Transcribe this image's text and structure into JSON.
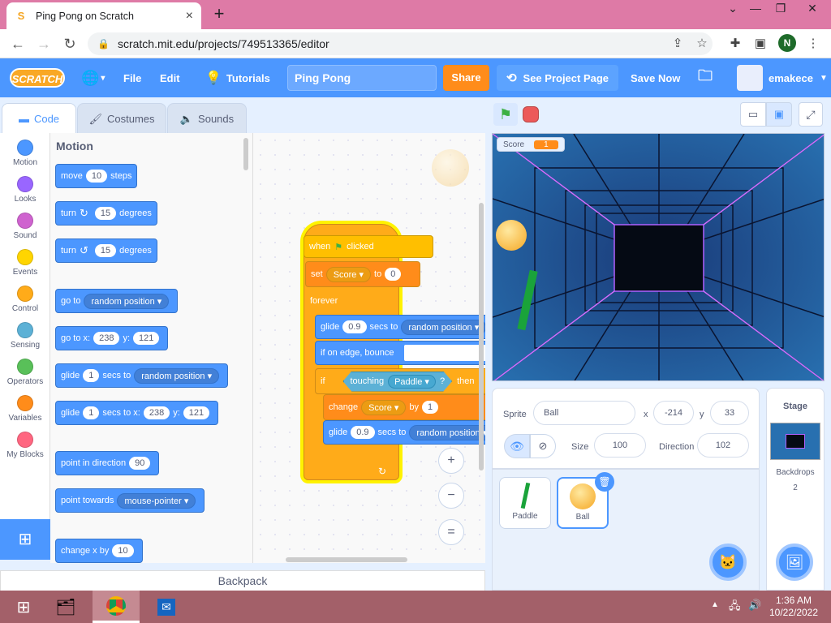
{
  "browser": {
    "tab_title": "Ping Pong on Scratch",
    "tab_favicon": "S",
    "new_tab": "+",
    "url": "scratch.mit.edu/projects/749513365/editor",
    "profile_initial": "N"
  },
  "menubar": {
    "logo": "SCRATCH",
    "file": "File",
    "edit": "Edit",
    "tutorials": "Tutorials",
    "project_title": "Ping Pong",
    "share": "Share",
    "see_project": "See Project Page",
    "save_now": "Save Now",
    "username": "emakece"
  },
  "tabs": {
    "code": "Code",
    "costumes": "Costumes",
    "sounds": "Sounds"
  },
  "categories": [
    {
      "label": "Motion",
      "color": "#4c97ff"
    },
    {
      "label": "Looks",
      "color": "#9966ff"
    },
    {
      "label": "Sound",
      "color": "#cf63cf"
    },
    {
      "label": "Events",
      "color": "#ffd500"
    },
    {
      "label": "Control",
      "color": "#ffab19"
    },
    {
      "label": "Sensing",
      "color": "#5cb1d6"
    },
    {
      "label": "Operators",
      "color": "#59c059"
    },
    {
      "label": "Variables",
      "color": "#ff8c1a"
    },
    {
      "label": "My Blocks",
      "color": "#ff6680"
    }
  ],
  "palette": {
    "header": "Motion",
    "move": {
      "a": "move",
      "v": "10",
      "b": "steps"
    },
    "turn_r": {
      "a": "turn",
      "v": "15",
      "b": "degrees"
    },
    "turn_l": {
      "a": "turn",
      "v": "15",
      "b": "degrees"
    },
    "goto": {
      "a": "go to",
      "d": "random position"
    },
    "gotoxy": {
      "a": "go to x:",
      "x": "238",
      "yl": "y:",
      "y": "121"
    },
    "glide": {
      "a": "glide",
      "v": "1",
      "b": "secs to",
      "d": "random position"
    },
    "glidexy": {
      "a": "glide",
      "v": "1",
      "b": "secs to x:",
      "x": "238",
      "yl": "y:",
      "y": "121"
    },
    "point": {
      "a": "point in direction",
      "v": "90"
    },
    "towards": {
      "a": "point towards",
      "d": "mouse-pointer"
    },
    "changex": {
      "a": "change x by",
      "v": "10"
    }
  },
  "script": {
    "hat": {
      "a": "when",
      "b": "clicked"
    },
    "set": {
      "a": "set",
      "d": "Score",
      "b": "to",
      "v": "0"
    },
    "forever": "forever",
    "glide": {
      "a": "glide",
      "v": "0.9",
      "b": "secs to",
      "d": "random position"
    },
    "bounce": "if on edge, bounce",
    "if": {
      "a": "if",
      "c": "touching",
      "d": "Paddle",
      "q": "?",
      "b": "then"
    },
    "change": {
      "a": "change",
      "d": "Score",
      "b": "by",
      "v": "1"
    },
    "glide2": {
      "a": "glide",
      "v": "0.9",
      "b": "secs to",
      "d": "random position"
    }
  },
  "zoom": {
    "in": "+",
    "out": "−",
    "reset": "="
  },
  "backpack": "Backpack",
  "stage": {
    "monitor_label": "Score",
    "monitor_value": "1"
  },
  "sprite_info": {
    "sprite_label": "Sprite",
    "sprite_name": "Ball",
    "x_label": "x",
    "x": "-214",
    "y_label": "y",
    "y": "33",
    "size_label": "Size",
    "size": "100",
    "direction_label": "Direction",
    "direction": "102"
  },
  "sprites": [
    {
      "name": "Paddle"
    },
    {
      "name": "Ball"
    }
  ],
  "stage_pane": {
    "title": "Stage",
    "backdrops_label": "Backdrops",
    "backdrops_count": "2"
  },
  "taskbar": {
    "time": "1:36 AM",
    "date": "10/22/2022"
  }
}
